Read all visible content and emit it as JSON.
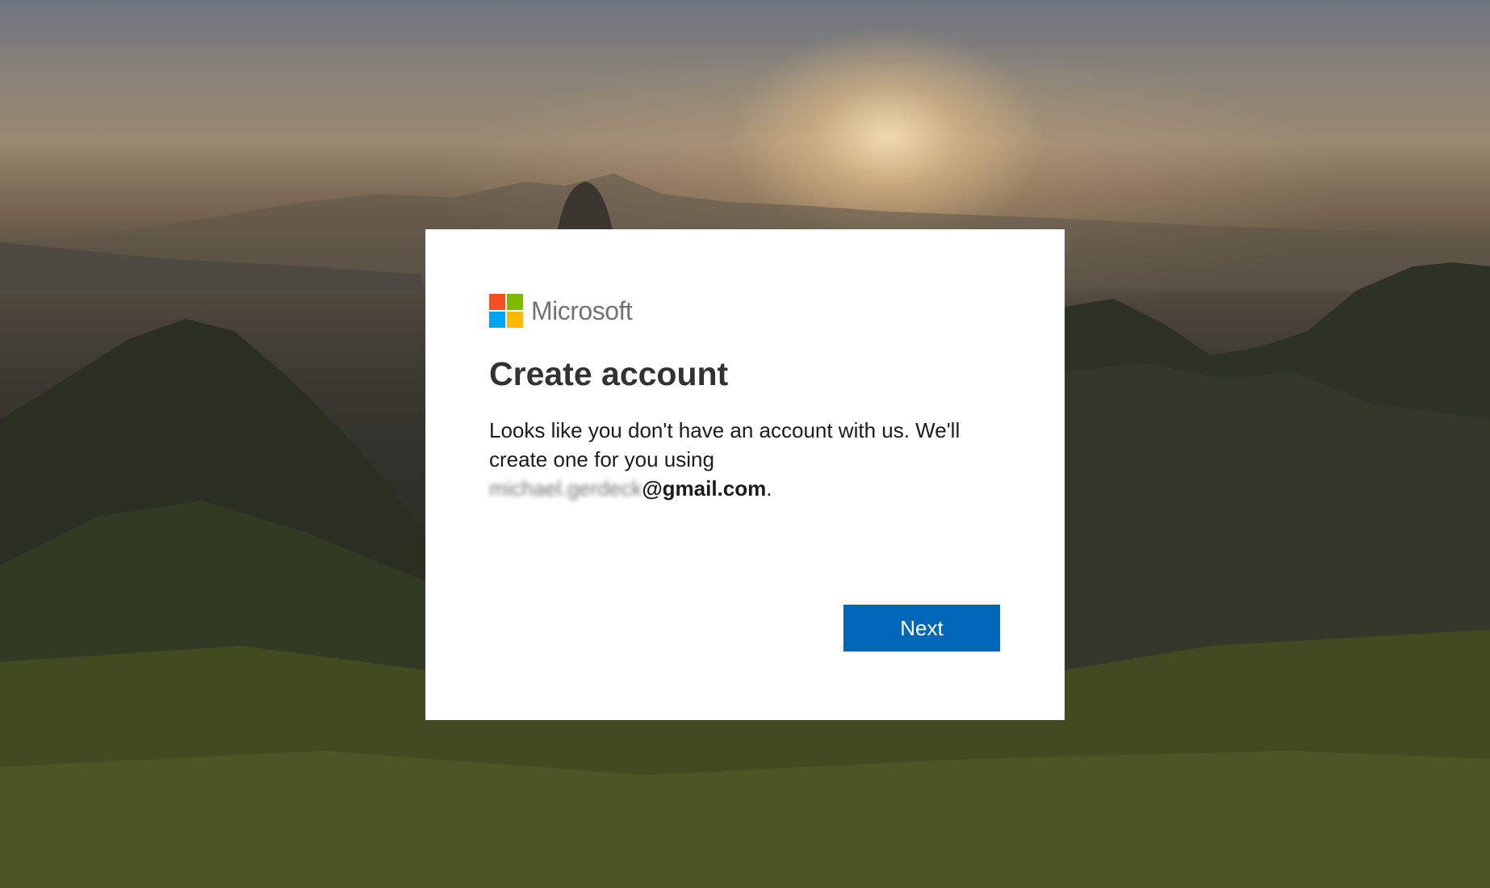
{
  "brand": {
    "name": "Microsoft",
    "logo_colors": [
      "#f25022",
      "#7fba00",
      "#00a4ef",
      "#ffb900"
    ]
  },
  "dialog": {
    "title": "Create account",
    "message": "Looks like you don't have an account with us. We'll create one for you using",
    "email_local_redacted": "michael.gerdeck",
    "email_domain": "@gmail.com",
    "message_end": "."
  },
  "actions": {
    "next_label": "Next"
  },
  "colors": {
    "primary_button": "#0067b8",
    "card_background": "#ffffff"
  }
}
